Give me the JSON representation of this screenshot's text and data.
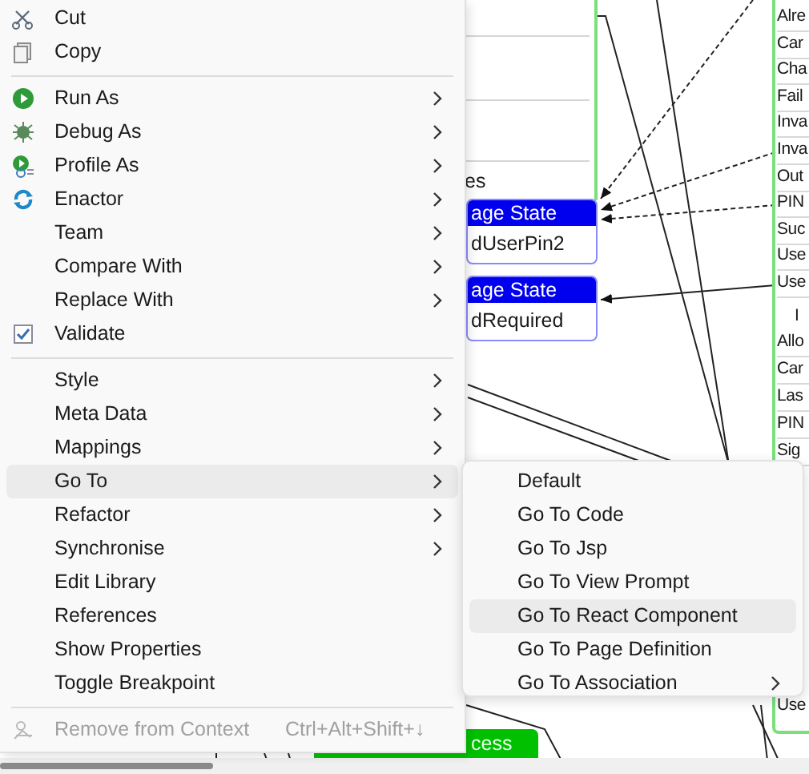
{
  "diagram": {
    "left_label": "es",
    "state_boxes": [
      {
        "title": "age State",
        "name": "dUserPin2"
      },
      {
        "title": "age State",
        "name": "dRequired"
      }
    ],
    "right_list": [
      "Alre",
      "Car",
      "Cha",
      "Fail",
      "Inva",
      "Inva",
      "Out",
      "PIN",
      "Suc",
      "Use",
      "Use"
    ],
    "right_group_header": "I",
    "right_list_2": [
      "Allo",
      "Car",
      "Las",
      "PIN",
      "Sig"
    ],
    "bottom_right_item": "Use",
    "end_box": "cess"
  },
  "context_menu": {
    "items": [
      {
        "kind": "item",
        "label": "Cut",
        "submenu": false,
        "selected": false,
        "disabled": false
      },
      {
        "kind": "item",
        "label": "Copy",
        "submenu": false,
        "selected": false,
        "disabled": false
      },
      {
        "kind": "separator"
      },
      {
        "kind": "item",
        "label": "Run As",
        "submenu": true,
        "selected": false,
        "disabled": false
      },
      {
        "kind": "item",
        "label": "Debug As",
        "submenu": true,
        "selected": false,
        "disabled": false
      },
      {
        "kind": "item",
        "label": "Profile As",
        "submenu": true,
        "selected": false,
        "disabled": false
      },
      {
        "kind": "item",
        "label": "Enactor",
        "submenu": true,
        "selected": false,
        "disabled": false
      },
      {
        "kind": "item",
        "label": "Team",
        "submenu": true,
        "selected": false,
        "disabled": false
      },
      {
        "kind": "item",
        "label": "Compare With",
        "submenu": true,
        "selected": false,
        "disabled": false
      },
      {
        "kind": "item",
        "label": "Replace With",
        "submenu": true,
        "selected": false,
        "disabled": false
      },
      {
        "kind": "item",
        "label": "Validate",
        "submenu": false,
        "selected": false,
        "disabled": false
      },
      {
        "kind": "separator"
      },
      {
        "kind": "item",
        "label": "Style",
        "submenu": true,
        "selected": false,
        "disabled": false
      },
      {
        "kind": "item",
        "label": "Meta Data",
        "submenu": true,
        "selected": false,
        "disabled": false
      },
      {
        "kind": "item",
        "label": "Mappings",
        "submenu": true,
        "selected": false,
        "disabled": false
      },
      {
        "kind": "item",
        "label": "Go To",
        "submenu": true,
        "selected": true,
        "disabled": false
      },
      {
        "kind": "item",
        "label": "Refactor",
        "submenu": true,
        "selected": false,
        "disabled": false
      },
      {
        "kind": "item",
        "label": "Synchronise",
        "submenu": true,
        "selected": false,
        "disabled": false
      },
      {
        "kind": "item",
        "label": "Edit Library",
        "submenu": false,
        "selected": false,
        "disabled": false
      },
      {
        "kind": "item",
        "label": "References",
        "submenu": false,
        "selected": false,
        "disabled": false
      },
      {
        "kind": "item",
        "label": "Show Properties",
        "submenu": false,
        "selected": false,
        "disabled": false
      },
      {
        "kind": "item",
        "label": "Toggle Breakpoint",
        "submenu": false,
        "selected": false,
        "disabled": false
      },
      {
        "kind": "separator"
      },
      {
        "kind": "item",
        "label": "Remove from Context",
        "shortcut": "Ctrl+Alt+Shift+↓",
        "submenu": false,
        "selected": false,
        "disabled": true
      }
    ]
  },
  "submenu": {
    "items": [
      {
        "label": "Default",
        "submenu": false,
        "selected": false
      },
      {
        "label": "Go To Code",
        "submenu": false,
        "selected": false
      },
      {
        "label": "Go To Jsp",
        "submenu": false,
        "selected": false
      },
      {
        "label": "Go To View Prompt",
        "submenu": false,
        "selected": false
      },
      {
        "label": "Go To React Component",
        "submenu": false,
        "selected": true
      },
      {
        "label": "Go To Page Definition",
        "submenu": false,
        "selected": false
      },
      {
        "label": "Go To Association",
        "submenu": true,
        "selected": false
      }
    ]
  }
}
